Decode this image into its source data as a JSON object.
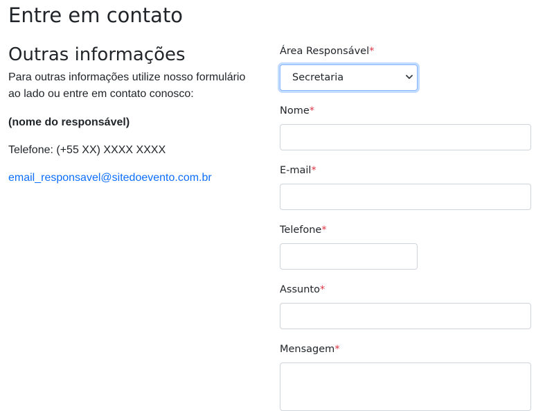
{
  "page": {
    "title": "Entre em contato"
  },
  "info": {
    "title": "Outras informações",
    "description": "Para outras informações utilize nosso formulário ao lado ou entre em contato conosco:",
    "responsible": "(nome do responsável)",
    "phone": "Telefone: (+55 XX) XXXX XXXX",
    "email": "email_responsavel@sitedoevento.com.br",
    "link_color": "#0d6efd"
  },
  "form": {
    "required_marker": "*",
    "required_color": "#dc3545",
    "area": {
      "label": "Área Responsável",
      "selected": "Secretaria"
    },
    "name": {
      "label": "Nome",
      "value": ""
    },
    "email": {
      "label": "E-mail",
      "value": ""
    },
    "phone": {
      "label": "Telefone",
      "value": ""
    },
    "subject": {
      "label": "Assunto",
      "value": ""
    },
    "message": {
      "label": "Mensagem",
      "value": ""
    }
  }
}
